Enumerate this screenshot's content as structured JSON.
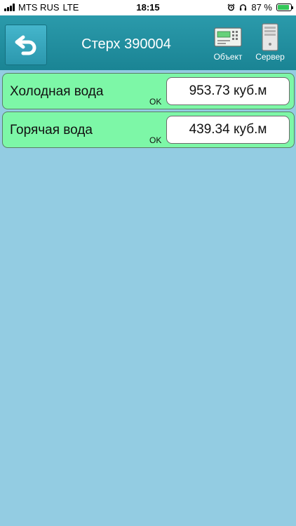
{
  "status_bar": {
    "carrier": "MTS RUS",
    "network": "LTE",
    "time": "18:15",
    "battery_percent": "87 %",
    "battery_level": 0.87,
    "icons": [
      "signal-bars-icon",
      "alarm-icon",
      "headphones-icon",
      "battery-charging-icon"
    ]
  },
  "header": {
    "title": "Стерх 390004",
    "back_icon": "undo-arrow-icon",
    "object_label": "Объект",
    "server_label": "Сервер",
    "colors": {
      "bar": "#2196a6",
      "back_button": "#3aaec4"
    }
  },
  "readings": [
    {
      "name": "Холодная вода",
      "value": "953.73 куб.м",
      "status": "OK"
    },
    {
      "name": "Горячая вода",
      "value": "439.34 куб.м",
      "status": "OK"
    }
  ],
  "colors": {
    "background": "#93cce2",
    "row_ok": "#7df7a7"
  }
}
